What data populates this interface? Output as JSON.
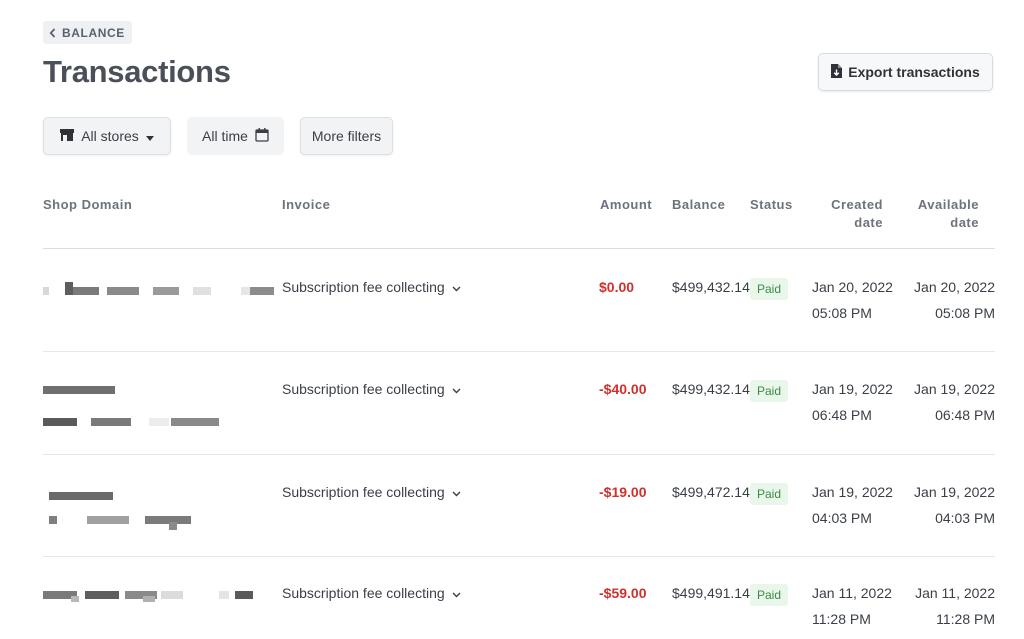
{
  "header": {
    "back_label": "BALANCE",
    "title": "Transactions",
    "export_label": "Export transactions"
  },
  "filters": {
    "stores_label": "All stores",
    "time_label": "All time",
    "more_label": "More filters"
  },
  "table": {
    "columns": {
      "shop_domain": "Shop Domain",
      "invoice": "Invoice",
      "amount": "Amount",
      "balance": "Balance",
      "status": "Status",
      "created_line1": "Created",
      "created_line2": "date",
      "available_line1": "Available",
      "available_line2": "date"
    },
    "rows": [
      {
        "invoice": "Subscription fee collecting",
        "amount": "$0.00",
        "balance": "$499,432.14",
        "status": "Paid",
        "created_date": "Jan 20, 2022",
        "created_time": "05:08 PM",
        "available_date": "Jan 20, 2022",
        "available_time": "05:08 PM"
      },
      {
        "invoice": "Subscription fee collecting",
        "amount": "-$40.00",
        "balance": "$499,432.14",
        "status": "Paid",
        "created_date": "Jan 19, 2022",
        "created_time": "06:48 PM",
        "available_date": "Jan 19, 2022",
        "available_time": "06:48 PM"
      },
      {
        "invoice": "Subscription fee collecting",
        "amount": "-$19.00",
        "balance": "$499,472.14",
        "status": "Paid",
        "created_date": "Jan 19, 2022",
        "created_time": "04:03 PM",
        "available_date": "Jan 19, 2022",
        "available_time": "04:03 PM"
      },
      {
        "invoice": "Subscription fee collecting",
        "amount": "-$59.00",
        "balance": "$499,491.14",
        "status": "Paid",
        "created_date": "Jan 11, 2022",
        "created_time": "11:28 PM",
        "available_date": "Jan 11, 2022",
        "available_time": "11:28 PM"
      }
    ]
  },
  "colors": {
    "amount_negative": "#d0312d",
    "status_paid_bg": "#e9f6ea",
    "status_paid_text": "#3c8a45"
  }
}
